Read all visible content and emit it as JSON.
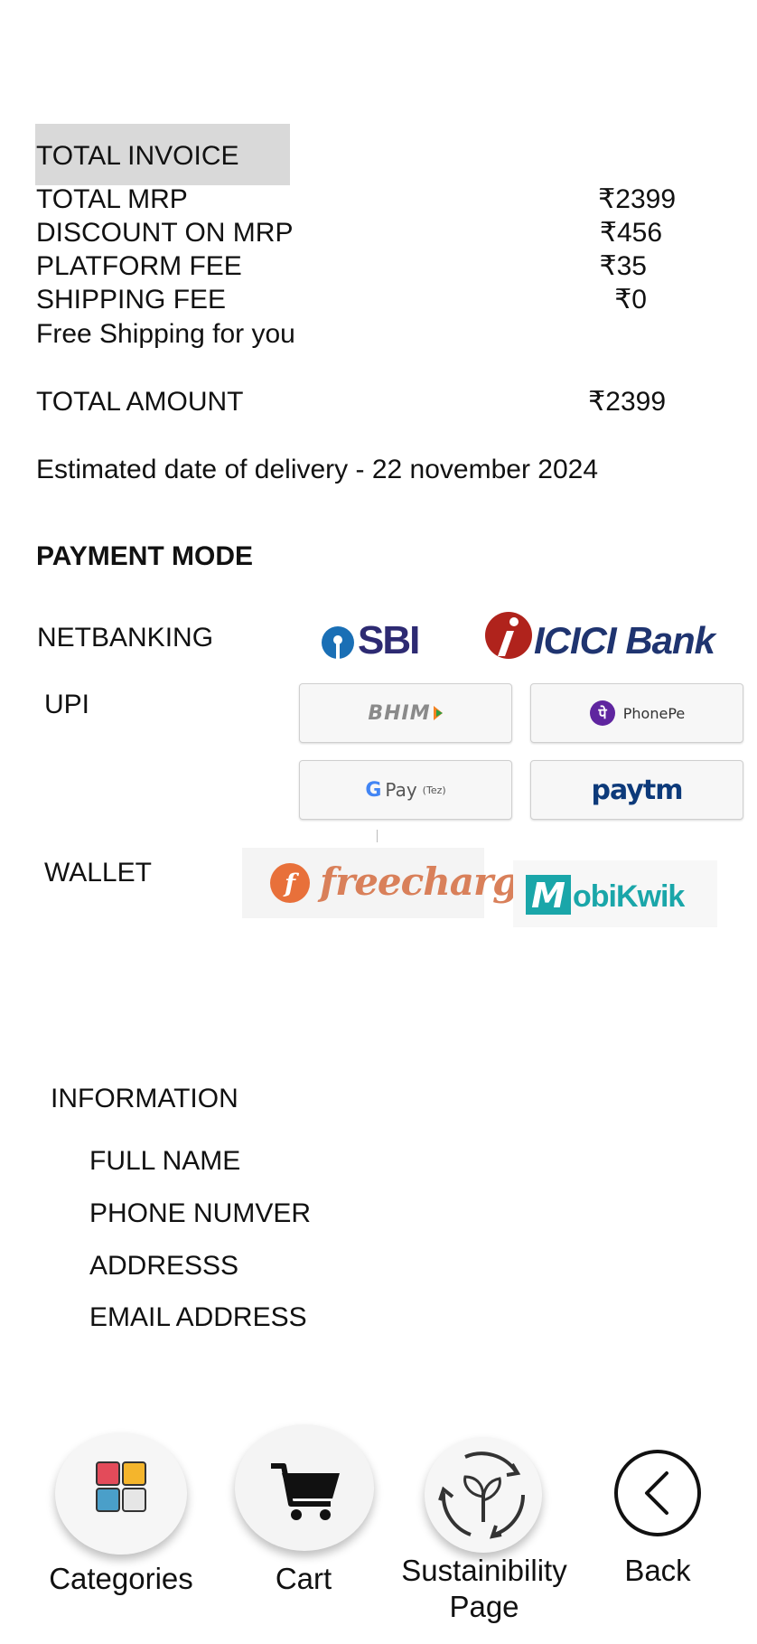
{
  "invoice": {
    "title": "TOTAL INVOICE",
    "rows": [
      {
        "label": "TOTAL MRP",
        "value": "₹2399"
      },
      {
        "label": "DISCOUNT ON MRP",
        "value": "₹456"
      },
      {
        "label": "PLATFORM FEE",
        "value": "₹35"
      },
      {
        "label": "SHIPPING FEE",
        "value": "₹0"
      }
    ],
    "shipping_note": "Free Shipping for you",
    "total_label": "TOTAL AMOUNT",
    "total_value": "₹2399",
    "delivery": "Estimated date of delivery - 22 november 2024"
  },
  "payment": {
    "title": "PAYMENT MODE",
    "netbanking_label": "NETBANKING",
    "upi_label": "UPI",
    "wallet_label": "WALLET",
    "banks": {
      "sbi": "SBI",
      "icici": "ICICI Bank"
    },
    "upi_apps": {
      "bhim": "BHIM",
      "phonepe": "PhonePe",
      "gpay": "Pay",
      "gpay_sub": "(Tez)",
      "paytm": "paytm"
    },
    "wallets": {
      "freecharge": "freecharg",
      "mobikwik": "obiKwik"
    }
  },
  "information": {
    "title": "INFORMATION",
    "fields": [
      "FULL NAME",
      "PHONE NUMVER",
      "ADDRESSS",
      "EMAIL ADDRESS"
    ]
  },
  "nav": {
    "categories": "Categories",
    "cart": "Cart",
    "sustainability_line1": "Sustainibility",
    "sustainability_line2": "Page",
    "back": "Back"
  },
  "colors": {
    "sbi_blue": "#1a6fb5",
    "icici_red": "#b0231c",
    "icici_navy": "#1f3470",
    "phonepe_purple": "#5f259f",
    "paytm_navy": "#0d3a7a",
    "paytm_blue": "#00baf2",
    "freecharge_orange": "#e8703a",
    "mobikwik_teal": "#1aa6a9",
    "tile_red": "#e34b5a",
    "tile_yellow": "#f4b52c",
    "tile_blue": "#4a9fc9"
  }
}
